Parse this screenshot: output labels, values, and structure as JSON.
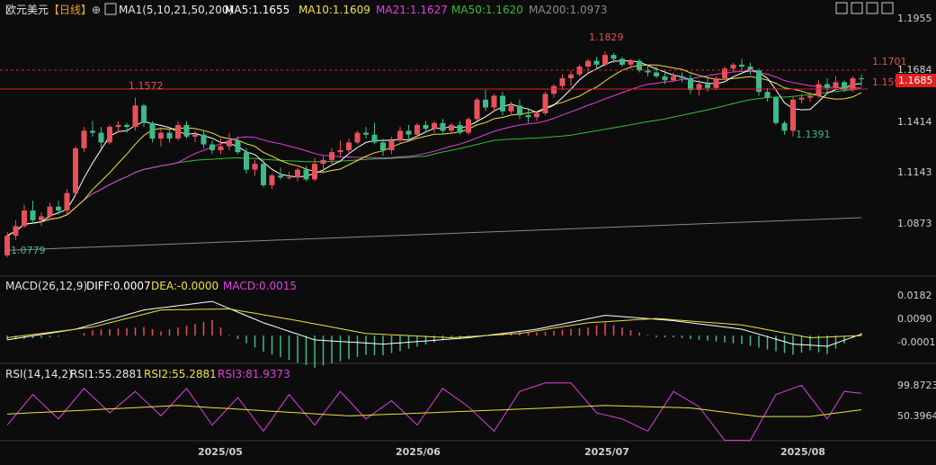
{
  "header": {
    "symbol": "欧元美元",
    "period": "【日线】",
    "ma_group": "MA1(5,10,21,50,200)",
    "ma5": "MA5:1.1655",
    "ma10": "MA10:1.1609",
    "ma21": "MA21:1.1627",
    "ma50": "MA50:1.1620",
    "ma200": "MA200:1.0973"
  },
  "macd_header": {
    "name": "MACD(26,12,9)",
    "diff": "DIFF:0.0007",
    "dea": "DEA:-0.0000",
    "macd": "MACD:0.0015"
  },
  "rsi_header": {
    "name": "RSI(14,14,2)",
    "rsi1": "RSI1:55.2881",
    "rsi2": "RSI2:55.2881",
    "rsi3": "RSI3:81.9373"
  },
  "annotations": {
    "high": "1.1829",
    "low": "1.0779",
    "mid_high": "1.1572",
    "recent_low": "1.1391",
    "red_line_upper": "1.1701",
    "red_line_lower": "1.1593",
    "current_price": "1.1685"
  },
  "axis": {
    "price_ticks": [
      "1.1955",
      "1.1684",
      "1.1414",
      "1.1143",
      "1.0873"
    ],
    "macd_ticks": [
      "0.0182",
      "0.0090",
      "-0.0001"
    ],
    "rsi_ticks": [
      "99.8723",
      "50.3964"
    ],
    "date_labels": [
      "2025/05",
      "2025/06",
      "2025/07",
      "2025/08"
    ]
  },
  "colors": {
    "up": "#e8505b",
    "down": "#3fb98a",
    "ma5": "#ffffff",
    "ma10": "#f0e040",
    "ma21": "#e040e0",
    "ma50": "#30c030",
    "ma200": "#8a8a8a",
    "ref_line": "#e02020",
    "diff": "#ffffff",
    "dea": "#f0e040",
    "rsi1": "#f0e040",
    "rsi3": "#e040e0"
  },
  "icons": [
    "target-icon",
    "crosshair-icon",
    "grid-icon",
    "chart-icon",
    "maximize-icon"
  ],
  "chart_data": {
    "type": "candlestick",
    "price_range": [
      1.0705,
      1.2
    ],
    "macd_range": [
      -0.013,
      0.019
    ],
    "rsi_range": [
      0,
      100
    ],
    "candles": [
      [
        1.0779,
        1.09,
        1.077,
        1.088
      ],
      [
        1.088,
        1.096,
        1.086,
        1.093
      ],
      [
        1.093,
        1.104,
        1.092,
        1.101
      ],
      [
        1.101,
        1.106,
        1.094,
        1.096
      ],
      [
        1.096,
        1.1,
        1.093,
        1.098
      ],
      [
        1.098,
        1.105,
        1.096,
        1.103
      ],
      [
        1.103,
        1.106,
        1.099,
        1.101
      ],
      [
        1.101,
        1.112,
        1.099,
        1.11
      ],
      [
        1.11,
        1.134,
        1.109,
        1.133
      ],
      [
        1.133,
        1.144,
        1.131,
        1.142
      ],
      [
        1.142,
        1.147,
        1.139,
        1.141
      ],
      [
        1.141,
        1.144,
        1.133,
        1.136
      ],
      [
        1.136,
        1.145,
        1.135,
        1.144
      ],
      [
        1.144,
        1.147,
        1.141,
        1.145
      ],
      [
        1.145,
        1.146,
        1.141,
        1.144
      ],
      [
        1.144,
        1.159,
        1.142,
        1.155
      ],
      [
        1.155,
        1.156,
        1.144,
        1.146
      ],
      [
        1.146,
        1.147,
        1.136,
        1.138
      ],
      [
        1.138,
        1.143,
        1.134,
        1.141
      ],
      [
        1.141,
        1.144,
        1.136,
        1.138
      ],
      [
        1.138,
        1.147,
        1.137,
        1.145
      ],
      [
        1.145,
        1.147,
        1.138,
        1.139
      ],
      [
        1.139,
        1.142,
        1.136,
        1.14
      ],
      [
        1.14,
        1.142,
        1.133,
        1.135
      ],
      [
        1.135,
        1.137,
        1.13,
        1.132
      ],
      [
        1.132,
        1.138,
        1.13,
        1.134
      ],
      [
        1.134,
        1.141,
        1.132,
        1.137
      ],
      [
        1.137,
        1.139,
        1.13,
        1.131
      ],
      [
        1.131,
        1.133,
        1.12,
        1.122
      ],
      [
        1.122,
        1.127,
        1.119,
        1.125
      ],
      [
        1.125,
        1.127,
        1.113,
        1.114
      ],
      [
        1.114,
        1.12,
        1.112,
        1.119
      ],
      [
        1.119,
        1.123,
        1.117,
        1.118
      ],
      [
        1.118,
        1.121,
        1.117,
        1.118
      ],
      [
        1.118,
        1.123,
        1.116,
        1.122
      ],
      [
        1.122,
        1.124,
        1.116,
        1.117
      ],
      [
        1.117,
        1.128,
        1.116,
        1.125
      ],
      [
        1.125,
        1.129,
        1.12,
        1.127
      ],
      [
        1.127,
        1.133,
        1.124,
        1.131
      ],
      [
        1.131,
        1.137,
        1.129,
        1.132
      ],
      [
        1.132,
        1.138,
        1.13,
        1.136
      ],
      [
        1.136,
        1.142,
        1.135,
        1.141
      ],
      [
        1.141,
        1.144,
        1.138,
        1.14
      ],
      [
        1.14,
        1.146,
        1.135,
        1.136
      ],
      [
        1.136,
        1.138,
        1.129,
        1.132
      ],
      [
        1.132,
        1.139,
        1.13,
        1.137
      ],
      [
        1.137,
        1.144,
        1.135,
        1.142
      ],
      [
        1.142,
        1.145,
        1.138,
        1.14
      ],
      [
        1.14,
        1.146,
        1.139,
        1.145
      ],
      [
        1.145,
        1.147,
        1.141,
        1.143
      ],
      [
        1.143,
        1.147,
        1.141,
        1.146
      ],
      [
        1.146,
        1.148,
        1.14,
        1.142
      ],
      [
        1.142,
        1.146,
        1.141,
        1.145
      ],
      [
        1.145,
        1.147,
        1.14,
        1.141
      ],
      [
        1.141,
        1.149,
        1.14,
        1.148
      ],
      [
        1.148,
        1.159,
        1.147,
        1.158
      ],
      [
        1.158,
        1.163,
        1.152,
        1.154
      ],
      [
        1.154,
        1.161,
        1.152,
        1.16
      ],
      [
        1.16,
        1.162,
        1.15,
        1.152
      ],
      [
        1.152,
        1.157,
        1.15,
        1.155
      ],
      [
        1.155,
        1.158,
        1.148,
        1.15
      ],
      [
        1.15,
        1.153,
        1.146,
        1.149
      ],
      [
        1.149,
        1.152,
        1.147,
        1.151
      ],
      [
        1.151,
        1.162,
        1.15,
        1.161
      ],
      [
        1.161,
        1.166,
        1.159,
        1.165
      ],
      [
        1.165,
        1.171,
        1.163,
        1.169
      ],
      [
        1.169,
        1.173,
        1.165,
        1.171
      ],
      [
        1.171,
        1.176,
        1.17,
        1.175
      ],
      [
        1.175,
        1.179,
        1.172,
        1.178
      ],
      [
        1.178,
        1.18,
        1.174,
        1.176
      ],
      [
        1.176,
        1.1829,
        1.175,
        1.181
      ],
      [
        1.181,
        1.182,
        1.177,
        1.179
      ],
      [
        1.179,
        1.18,
        1.175,
        1.176
      ],
      [
        1.176,
        1.179,
        1.174,
        1.178
      ],
      [
        1.178,
        1.179,
        1.172,
        1.173
      ],
      [
        1.173,
        1.176,
        1.17,
        1.172
      ],
      [
        1.172,
        1.175,
        1.169,
        1.17
      ],
      [
        1.17,
        1.173,
        1.166,
        1.168
      ],
      [
        1.168,
        1.172,
        1.167,
        1.17
      ],
      [
        1.17,
        1.172,
        1.167,
        1.169
      ],
      [
        1.169,
        1.171,
        1.161,
        1.163
      ],
      [
        1.163,
        1.168,
        1.16,
        1.166
      ],
      [
        1.166,
        1.169,
        1.162,
        1.164
      ],
      [
        1.164,
        1.17,
        1.163,
        1.169
      ],
      [
        1.169,
        1.175,
        1.168,
        1.174
      ],
      [
        1.174,
        1.177,
        1.172,
        1.176
      ],
      [
        1.176,
        1.179,
        1.173,
        1.175
      ],
      [
        1.175,
        1.177,
        1.171,
        1.173
      ],
      [
        1.173,
        1.174,
        1.16,
        1.162
      ],
      [
        1.162,
        1.164,
        1.157,
        1.159
      ],
      [
        1.159,
        1.16,
        1.145,
        1.146
      ],
      [
        1.146,
        1.147,
        1.14,
        1.142
      ],
      [
        1.142,
        1.16,
        1.1391,
        1.158
      ],
      [
        1.158,
        1.161,
        1.156,
        1.159
      ],
      [
        1.159,
        1.162,
        1.157,
        1.16
      ],
      [
        1.16,
        1.168,
        1.159,
        1.166
      ],
      [
        1.166,
        1.169,
        1.162,
        1.164
      ],
      [
        1.164,
        1.17,
        1.163,
        1.167
      ],
      [
        1.167,
        1.168,
        1.162,
        1.163
      ],
      [
        1.163,
        1.17,
        1.162,
        1.169
      ],
      [
        1.169,
        1.171,
        1.165,
        1.1685
      ]
    ],
    "ma200": [
      [
        0,
        1.0805
      ],
      [
        100,
        1.0973
      ]
    ],
    "macd": {
      "diff": [
        [
          0,
          -0.002
        ],
        [
          8,
          0.003
        ],
        [
          16,
          0.012
        ],
        [
          24,
          0.016
        ],
        [
          30,
          0.006
        ],
        [
          36,
          -0.002
        ],
        [
          44,
          -0.004
        ],
        [
          54,
          -0.001
        ],
        [
          62,
          0.003
        ],
        [
          70,
          0.0095
        ],
        [
          78,
          0.007
        ],
        [
          86,
          0.003
        ],
        [
          92,
          -0.004
        ],
        [
          96,
          -0.005
        ],
        [
          100,
          0.0007
        ]
      ],
      "dea": [
        [
          0,
          -0.001
        ],
        [
          10,
          0.004
        ],
        [
          18,
          0.012
        ],
        [
          26,
          0.0125
        ],
        [
          34,
          0.007
        ],
        [
          42,
          0.001
        ],
        [
          52,
          -0.001
        ],
        [
          60,
          0.001
        ],
        [
          68,
          0.006
        ],
        [
          76,
          0.008
        ],
        [
          86,
          0.005
        ],
        [
          94,
          -0.001
        ],
        [
          100,
          0.0
        ]
      ]
    },
    "rsi": {
      "rsi1": [
        [
          0,
          48
        ],
        [
          20,
          62
        ],
        [
          40,
          45
        ],
        [
          60,
          56
        ],
        [
          70,
          62
        ],
        [
          80,
          58
        ],
        [
          88,
          44
        ],
        [
          94,
          44
        ],
        [
          100,
          55
        ]
      ],
      "rsi3": [
        [
          0,
          30
        ],
        [
          3,
          80
        ],
        [
          6,
          40
        ],
        [
          9,
          90
        ],
        [
          12,
          50
        ],
        [
          15,
          85
        ],
        [
          18,
          45
        ],
        [
          21,
          90
        ],
        [
          24,
          30
        ],
        [
          27,
          75
        ],
        [
          30,
          20
        ],
        [
          33,
          80
        ],
        [
          36,
          30
        ],
        [
          39,
          85
        ],
        [
          42,
          40
        ],
        [
          45,
          70
        ],
        [
          48,
          30
        ],
        [
          51,
          90
        ],
        [
          54,
          60
        ],
        [
          57,
          20
        ],
        [
          60,
          85
        ],
        [
          63,
          99
        ],
        [
          66,
          99
        ],
        [
          69,
          50
        ],
        [
          72,
          40
        ],
        [
          75,
          20
        ],
        [
          78,
          85
        ],
        [
          81,
          60
        ],
        [
          84,
          5
        ],
        [
          87,
          5
        ],
        [
          90,
          80
        ],
        [
          93,
          95
        ],
        [
          96,
          40
        ],
        [
          98,
          85
        ],
        [
          100,
          82
        ]
      ]
    }
  }
}
